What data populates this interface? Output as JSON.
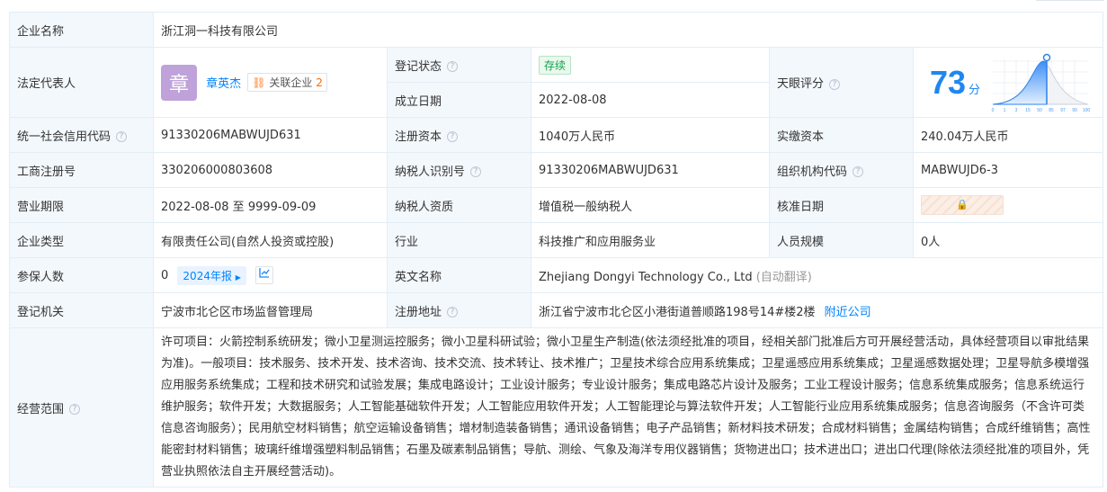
{
  "company_name": {
    "label": "企业名称",
    "value": "浙江洞一科技有限公司"
  },
  "legal_rep": {
    "label": "法定代表人",
    "avatar_char": "章",
    "name": "章英杰",
    "related_label": "关联企业",
    "related_count": "2"
  },
  "reg_status": {
    "label": "登记状态",
    "value": "存续"
  },
  "founded": {
    "label": "成立日期",
    "value": "2022-08-08"
  },
  "tianyan_score": {
    "label": "天眼评分",
    "score": "73",
    "unit": "分",
    "ticks": [
      "0",
      "1",
      "3",
      "15",
      "50",
      "85",
      "97",
      "99",
      "100"
    ],
    "score_percentile": 73
  },
  "credit_code": {
    "label": "统一社会信用代码",
    "value": "91330206MABWUJD631"
  },
  "reg_capital": {
    "label": "注册资本",
    "value": "1040万人民币"
  },
  "paid_capital": {
    "label": "实缴资本",
    "value": "240.04万人民币"
  },
  "biz_reg_no": {
    "label": "工商注册号",
    "value": "330206000803608"
  },
  "taxpayer_id": {
    "label": "纳税人识别号",
    "value": "91330206MABWUJD631"
  },
  "org_code": {
    "label": "组织机构代码",
    "value": "MABWUJD6-3"
  },
  "biz_term": {
    "label": "营业期限",
    "value": "2022-08-08 至 9999-09-09"
  },
  "taxpayer_qual": {
    "label": "纳税人资质",
    "value": "增值税一般纳税人"
  },
  "approval_date": {
    "label": "核准日期"
  },
  "company_type": {
    "label": "企业类型",
    "value": "有限责任公司(自然人投资或控股)"
  },
  "industry": {
    "label": "行业",
    "value": "科技推广和应用服务业"
  },
  "staff_size": {
    "label": "人员规模",
    "value": "0人"
  },
  "insured": {
    "label": "参保人数",
    "value": "0",
    "report": "2024年报"
  },
  "english_name": {
    "label": "英文名称",
    "value": "Zhejiang Dongyi Technology Co., Ltd",
    "note": "(自动翻译)"
  },
  "reg_authority": {
    "label": "登记机关",
    "value": "宁波市北仑区市场监督管理局"
  },
  "reg_address": {
    "label": "注册地址",
    "value": "浙江省宁波市北仑区小港街道普顺路198号14#楼2楼",
    "nearby": "附近公司"
  },
  "biz_scope": {
    "label": "经营范围",
    "value": "许可项目：火箭控制系统研发；微小卫星测运控服务；微小卫星科研试验；微小卫星生产制造(依法须经批准的项目，经相关部门批准后方可开展经营活动，具体经营项目以审批结果为准)。一般项目：技术服务、技术开发、技术咨询、技术交流、技术转让、技术推广；卫星技术综合应用系统集成；卫星遥感应用系统集成；卫星遥感数据处理；卫星导航多模增强应用服务系统集成；工程和技术研究和试验发展；集成电路设计；工业设计服务；专业设计服务；集成电路芯片设计及服务；工业工程设计服务；信息系统集成服务；信息系统运行维护服务；软件开发；大数据服务；人工智能基础软件开发；人工智能应用软件开发；人工智能理论与算法软件开发；人工智能行业应用系统集成服务；信息咨询服务（不含许可类信息咨询服务）；民用航空材料销售；航空运输设备销售；增材制造装备销售；通讯设备销售；电子产品销售；新材料技术研发；合成材料销售；金属结构销售；合成纤维销售；高性能密封材料销售；玻璃纤维增强塑料制品销售；石墨及碳素制品销售；导航、测绘、气象及海洋专用仪器销售；货物进出口；技术进出口；进出口代理(除依法须经批准的项目外，凭营业执照依法自主开展经营活动)。"
  }
}
